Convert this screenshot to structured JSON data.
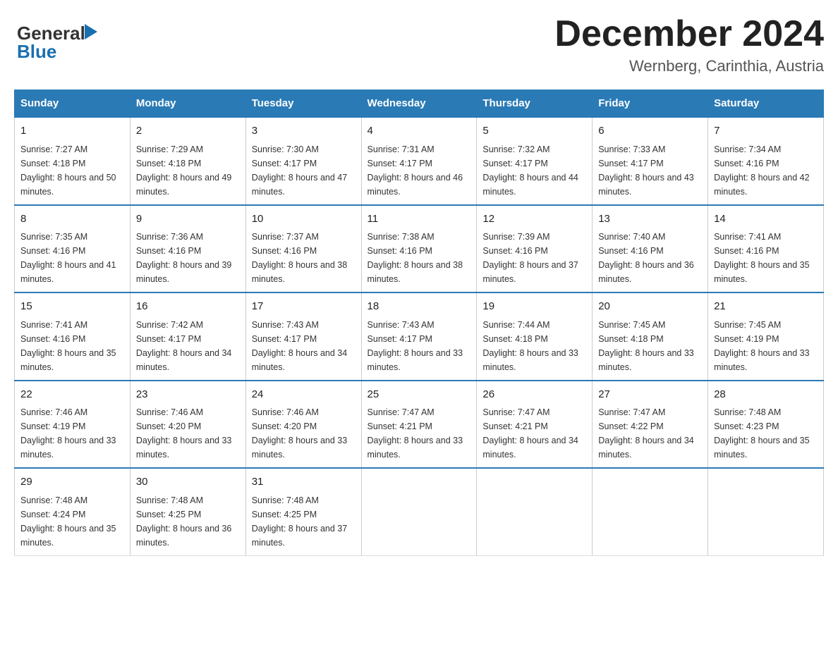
{
  "header": {
    "logo_general": "General",
    "logo_blue": "Blue",
    "month_title": "December 2024",
    "location": "Wernberg, Carinthia, Austria"
  },
  "days_of_week": [
    "Sunday",
    "Monday",
    "Tuesday",
    "Wednesday",
    "Thursday",
    "Friday",
    "Saturday"
  ],
  "weeks": [
    [
      {
        "day": "1",
        "sunrise": "7:27 AM",
        "sunset": "4:18 PM",
        "daylight": "8 hours and 50 minutes."
      },
      {
        "day": "2",
        "sunrise": "7:29 AM",
        "sunset": "4:18 PM",
        "daylight": "8 hours and 49 minutes."
      },
      {
        "day": "3",
        "sunrise": "7:30 AM",
        "sunset": "4:17 PM",
        "daylight": "8 hours and 47 minutes."
      },
      {
        "day": "4",
        "sunrise": "7:31 AM",
        "sunset": "4:17 PM",
        "daylight": "8 hours and 46 minutes."
      },
      {
        "day": "5",
        "sunrise": "7:32 AM",
        "sunset": "4:17 PM",
        "daylight": "8 hours and 44 minutes."
      },
      {
        "day": "6",
        "sunrise": "7:33 AM",
        "sunset": "4:17 PM",
        "daylight": "8 hours and 43 minutes."
      },
      {
        "day": "7",
        "sunrise": "7:34 AM",
        "sunset": "4:16 PM",
        "daylight": "8 hours and 42 minutes."
      }
    ],
    [
      {
        "day": "8",
        "sunrise": "7:35 AM",
        "sunset": "4:16 PM",
        "daylight": "8 hours and 41 minutes."
      },
      {
        "day": "9",
        "sunrise": "7:36 AM",
        "sunset": "4:16 PM",
        "daylight": "8 hours and 39 minutes."
      },
      {
        "day": "10",
        "sunrise": "7:37 AM",
        "sunset": "4:16 PM",
        "daylight": "8 hours and 38 minutes."
      },
      {
        "day": "11",
        "sunrise": "7:38 AM",
        "sunset": "4:16 PM",
        "daylight": "8 hours and 38 minutes."
      },
      {
        "day": "12",
        "sunrise": "7:39 AM",
        "sunset": "4:16 PM",
        "daylight": "8 hours and 37 minutes."
      },
      {
        "day": "13",
        "sunrise": "7:40 AM",
        "sunset": "4:16 PM",
        "daylight": "8 hours and 36 minutes."
      },
      {
        "day": "14",
        "sunrise": "7:41 AM",
        "sunset": "4:16 PM",
        "daylight": "8 hours and 35 minutes."
      }
    ],
    [
      {
        "day": "15",
        "sunrise": "7:41 AM",
        "sunset": "4:16 PM",
        "daylight": "8 hours and 35 minutes."
      },
      {
        "day": "16",
        "sunrise": "7:42 AM",
        "sunset": "4:17 PM",
        "daylight": "8 hours and 34 minutes."
      },
      {
        "day": "17",
        "sunrise": "7:43 AM",
        "sunset": "4:17 PM",
        "daylight": "8 hours and 34 minutes."
      },
      {
        "day": "18",
        "sunrise": "7:43 AM",
        "sunset": "4:17 PM",
        "daylight": "8 hours and 33 minutes."
      },
      {
        "day": "19",
        "sunrise": "7:44 AM",
        "sunset": "4:18 PM",
        "daylight": "8 hours and 33 minutes."
      },
      {
        "day": "20",
        "sunrise": "7:45 AM",
        "sunset": "4:18 PM",
        "daylight": "8 hours and 33 minutes."
      },
      {
        "day": "21",
        "sunrise": "7:45 AM",
        "sunset": "4:19 PM",
        "daylight": "8 hours and 33 minutes."
      }
    ],
    [
      {
        "day": "22",
        "sunrise": "7:46 AM",
        "sunset": "4:19 PM",
        "daylight": "8 hours and 33 minutes."
      },
      {
        "day": "23",
        "sunrise": "7:46 AM",
        "sunset": "4:20 PM",
        "daylight": "8 hours and 33 minutes."
      },
      {
        "day": "24",
        "sunrise": "7:46 AM",
        "sunset": "4:20 PM",
        "daylight": "8 hours and 33 minutes."
      },
      {
        "day": "25",
        "sunrise": "7:47 AM",
        "sunset": "4:21 PM",
        "daylight": "8 hours and 33 minutes."
      },
      {
        "day": "26",
        "sunrise": "7:47 AM",
        "sunset": "4:21 PM",
        "daylight": "8 hours and 34 minutes."
      },
      {
        "day": "27",
        "sunrise": "7:47 AM",
        "sunset": "4:22 PM",
        "daylight": "8 hours and 34 minutes."
      },
      {
        "day": "28",
        "sunrise": "7:48 AM",
        "sunset": "4:23 PM",
        "daylight": "8 hours and 35 minutes."
      }
    ],
    [
      {
        "day": "29",
        "sunrise": "7:48 AM",
        "sunset": "4:24 PM",
        "daylight": "8 hours and 35 minutes."
      },
      {
        "day": "30",
        "sunrise": "7:48 AM",
        "sunset": "4:25 PM",
        "daylight": "8 hours and 36 minutes."
      },
      {
        "day": "31",
        "sunrise": "7:48 AM",
        "sunset": "4:25 PM",
        "daylight": "8 hours and 37 minutes."
      },
      null,
      null,
      null,
      null
    ]
  ]
}
